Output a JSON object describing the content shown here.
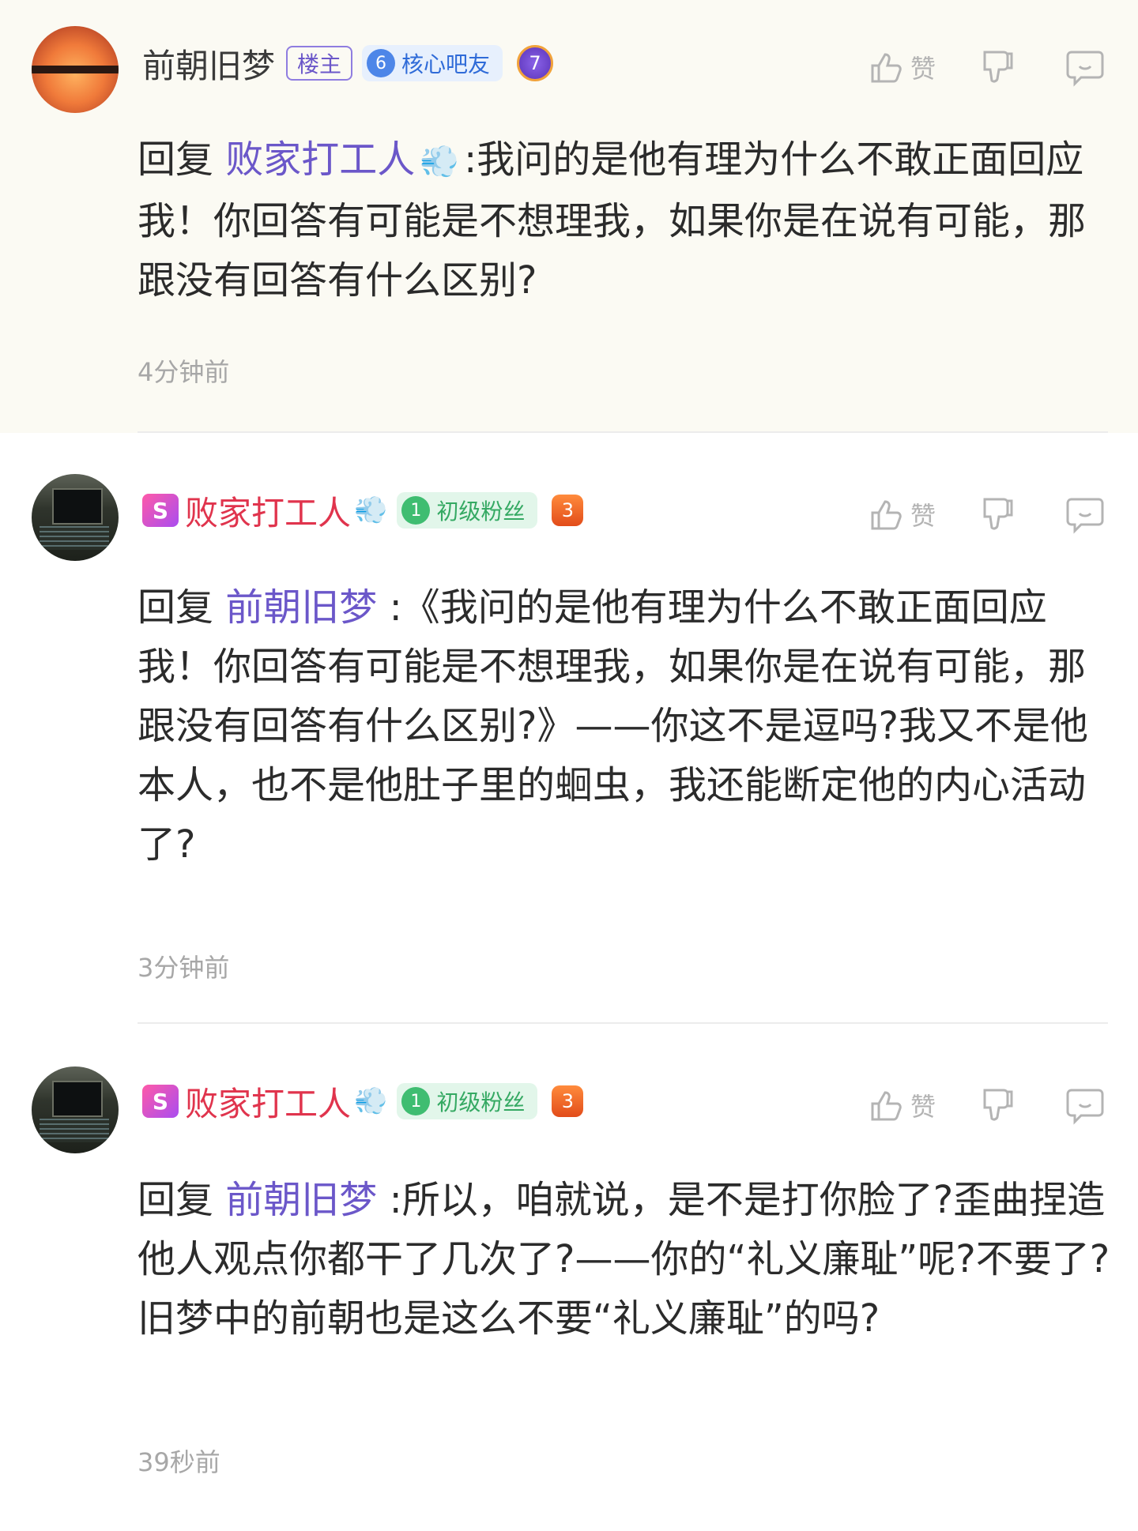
{
  "comments": [
    {
      "username": "前朝旧梦",
      "owner_tag": "楼主",
      "level": "6",
      "level_title": "核心吧友",
      "medal": "7",
      "like_label": "赞",
      "reply_prefix": "回复",
      "mention": "败家打工人",
      "text": ":我问的是他有理为什么不敢正面回应我！你回答有可能是不想理我，如果你是在说有可能，那跟没有回答有什么区别?",
      "time": "4分钟前"
    },
    {
      "username": "败家打工人",
      "vip_badge": "S",
      "level": "1",
      "level_title": "初级粉丝",
      "medal": "3",
      "like_label": "赞",
      "reply_prefix": "回复",
      "mention": "前朝旧梦",
      "text": ":《我问的是他有理为什么不敢正面回应我！你回答有可能是不想理我，如果你是在说有可能，那跟没有回答有什么区别?》——你这不是逗吗?我又不是他本人，也不是他肚子里的蛔虫，我还能断定他的内心活动了?",
      "time": "3分钟前"
    },
    {
      "username": "败家打工人",
      "vip_badge": "S",
      "level": "1",
      "level_title": "初级粉丝",
      "medal": "3",
      "like_label": "赞",
      "reply_prefix": "回复",
      "mention": "前朝旧梦",
      "text": ":所以，咱就说，是不是打你脸了?歪曲捏造他人观点你都干了几次了?——你的“礼义廉耻”呢?不要了?旧梦中的前朝也是这么不要“礼义廉耻”的吗?",
      "time": "39秒前"
    }
  ],
  "icons": {
    "wind": "wind-emoji-icon",
    "like": "thumbs-up-icon",
    "dislike": "thumbs-down-icon",
    "reply": "comment-bubble-icon"
  }
}
